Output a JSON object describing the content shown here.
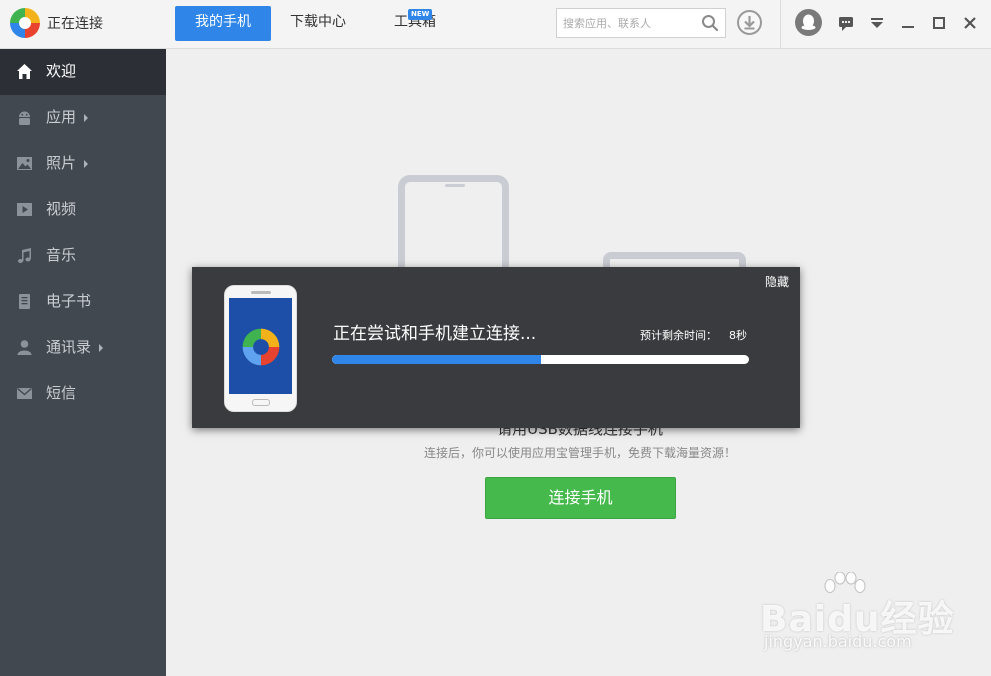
{
  "app": {
    "title": "正在连接",
    "colors": {
      "accent": "#2f86e8",
      "sidebar": "#424850",
      "success": "#45b94c"
    }
  },
  "topnav": {
    "tabs": [
      {
        "label": "我的手机",
        "active": true
      },
      {
        "label": "下载中心",
        "active": false
      },
      {
        "label": "工具箱",
        "active": false,
        "badge": "NEW"
      }
    ]
  },
  "search": {
    "placeholder": "搜索应用、联系人"
  },
  "sidebar": {
    "items": [
      {
        "label": "欢迎",
        "icon": "home-icon",
        "active": true,
        "has_submenu": false
      },
      {
        "label": "应用",
        "icon": "android-icon",
        "active": false,
        "has_submenu": true
      },
      {
        "label": "照片",
        "icon": "image-icon",
        "active": false,
        "has_submenu": true
      },
      {
        "label": "视频",
        "icon": "play-icon",
        "active": false,
        "has_submenu": false
      },
      {
        "label": "音乐",
        "icon": "music-note-icon",
        "active": false,
        "has_submenu": false
      },
      {
        "label": "电子书",
        "icon": "book-icon",
        "active": false,
        "has_submenu": false
      },
      {
        "label": "通讯录",
        "icon": "contact-icon",
        "active": false,
        "has_submenu": true
      },
      {
        "label": "短信",
        "icon": "envelope-icon",
        "active": false,
        "has_submenu": false
      }
    ]
  },
  "main": {
    "connect_title": "请用USB数据线连接手机",
    "connect_subtitle": "连接后，你可以使用应用宝管理手机，免费下载海量资源！",
    "connect_button": "连接手机"
  },
  "dialog": {
    "hide_label": "隐藏",
    "status": "正在尝试和手机建立连接...",
    "eta_label": "预计剩余时间：",
    "eta_value": "8秒",
    "progress": 0.5
  },
  "watermark": {
    "brand": "Baidu经验",
    "url": "jingyan.baidu.com"
  }
}
